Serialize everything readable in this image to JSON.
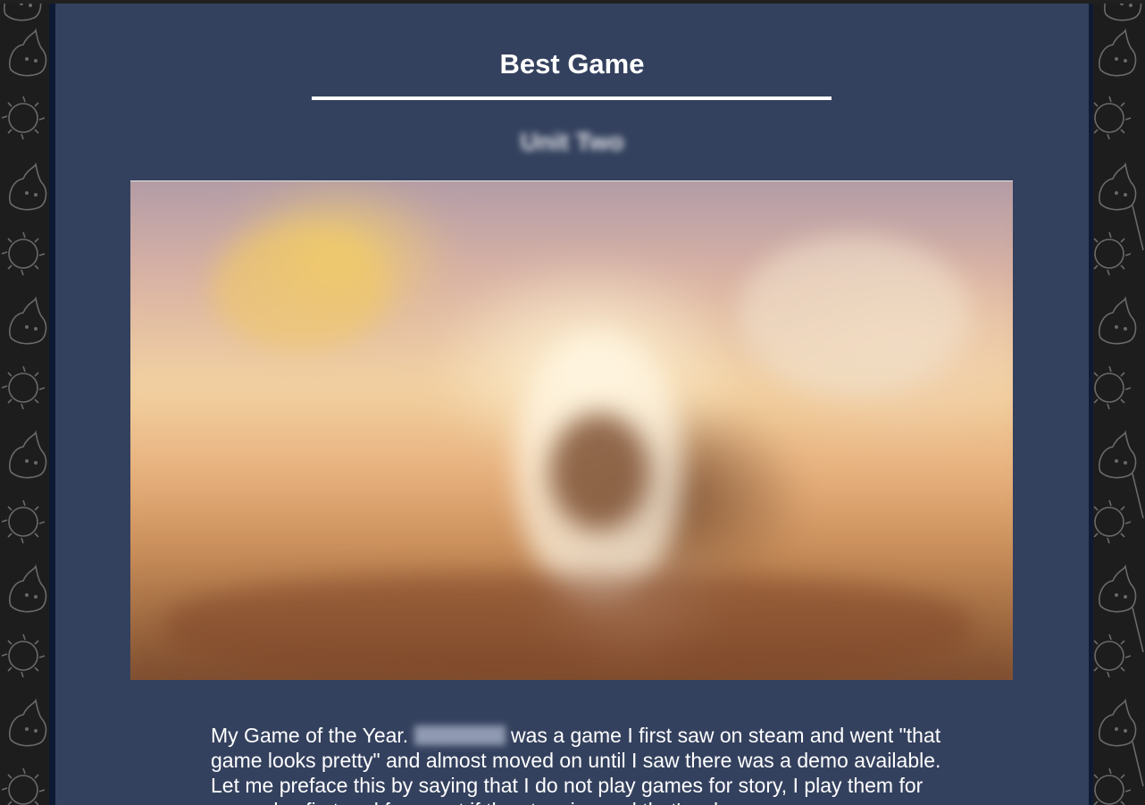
{
  "post": {
    "title": "Best Game",
    "author_blurred": "Unit Two",
    "game_name_blurred": "Arena",
    "body_before": "My Game of the Year. ",
    "body_after": " was a game I first saw on steam and went \"that game looks pretty\" and almost moved on until I saw there was a demo available. Let me preface this by saying that I do not play games for story, I play them for gameplay first and foremost if the story is good that's a bonus"
  },
  "hero_image": {
    "description": "blurred",
    "icon": "game-artwork-image"
  },
  "colors": {
    "panel": "#34415e",
    "frame": "#0e1a33",
    "text": "#ffffff"
  }
}
